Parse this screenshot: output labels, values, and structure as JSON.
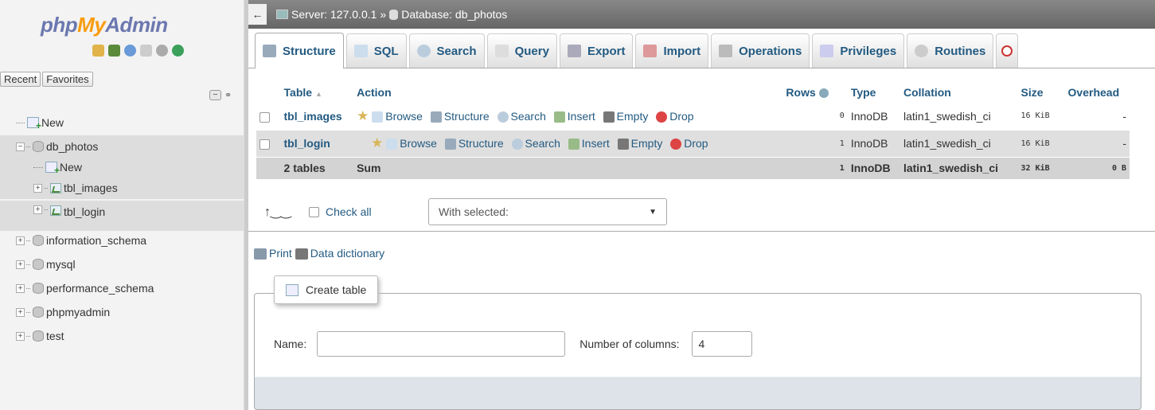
{
  "app": {
    "logo": {
      "part1": "php",
      "part2": "My",
      "part3": "Admin"
    }
  },
  "nav": {
    "recent_label": "Recent",
    "favorites_label": "Favorites",
    "new_label": "New",
    "databases": [
      {
        "name": "db_photos",
        "expanded": true,
        "children": [
          "New",
          "tbl_images",
          "tbl_login"
        ]
      },
      {
        "name": "information_schema"
      },
      {
        "name": "mysql"
      },
      {
        "name": "performance_schema"
      },
      {
        "name": "phpmyadmin"
      },
      {
        "name": "test"
      }
    ]
  },
  "breadcrumb": {
    "server": "Server: 127.0.0.1",
    "sep": "»",
    "database": "Database: db_photos"
  },
  "tabs": [
    "Structure",
    "SQL",
    "Search",
    "Query",
    "Export",
    "Import",
    "Operations",
    "Privileges",
    "Routines"
  ],
  "table": {
    "headers": {
      "table": "Table",
      "action": "Action",
      "rows": "Rows",
      "type": "Type",
      "collation": "Collation",
      "size": "Size",
      "overhead": "Overhead"
    },
    "actions": [
      "Browse",
      "Structure",
      "Search",
      "Insert",
      "Empty",
      "Drop"
    ],
    "rows": [
      {
        "name": "tbl_images",
        "rows": "0",
        "type": "InnoDB",
        "collation": "latin1_swedish_ci",
        "size": "16 KiB",
        "overhead": "-"
      },
      {
        "name": "tbl_login",
        "rows": "1",
        "type": "InnoDB",
        "collation": "latin1_swedish_ci",
        "size": "16 KiB",
        "overhead": "-"
      }
    ],
    "summary": {
      "name": "2 tables",
      "action": "Sum",
      "rows": "1",
      "type": "InnoDB",
      "collation": "latin1_swedish_ci",
      "size": "32 KiB",
      "overhead": "0 B"
    }
  },
  "bulk": {
    "check_all": "Check all",
    "with_selected": "With selected:"
  },
  "links": {
    "print": "Print",
    "data_dictionary": "Data dictionary"
  },
  "create": {
    "legend": "Create table",
    "name_label": "Name:",
    "name_value": "",
    "columns_label": "Number of columns:",
    "columns_value": "4"
  }
}
